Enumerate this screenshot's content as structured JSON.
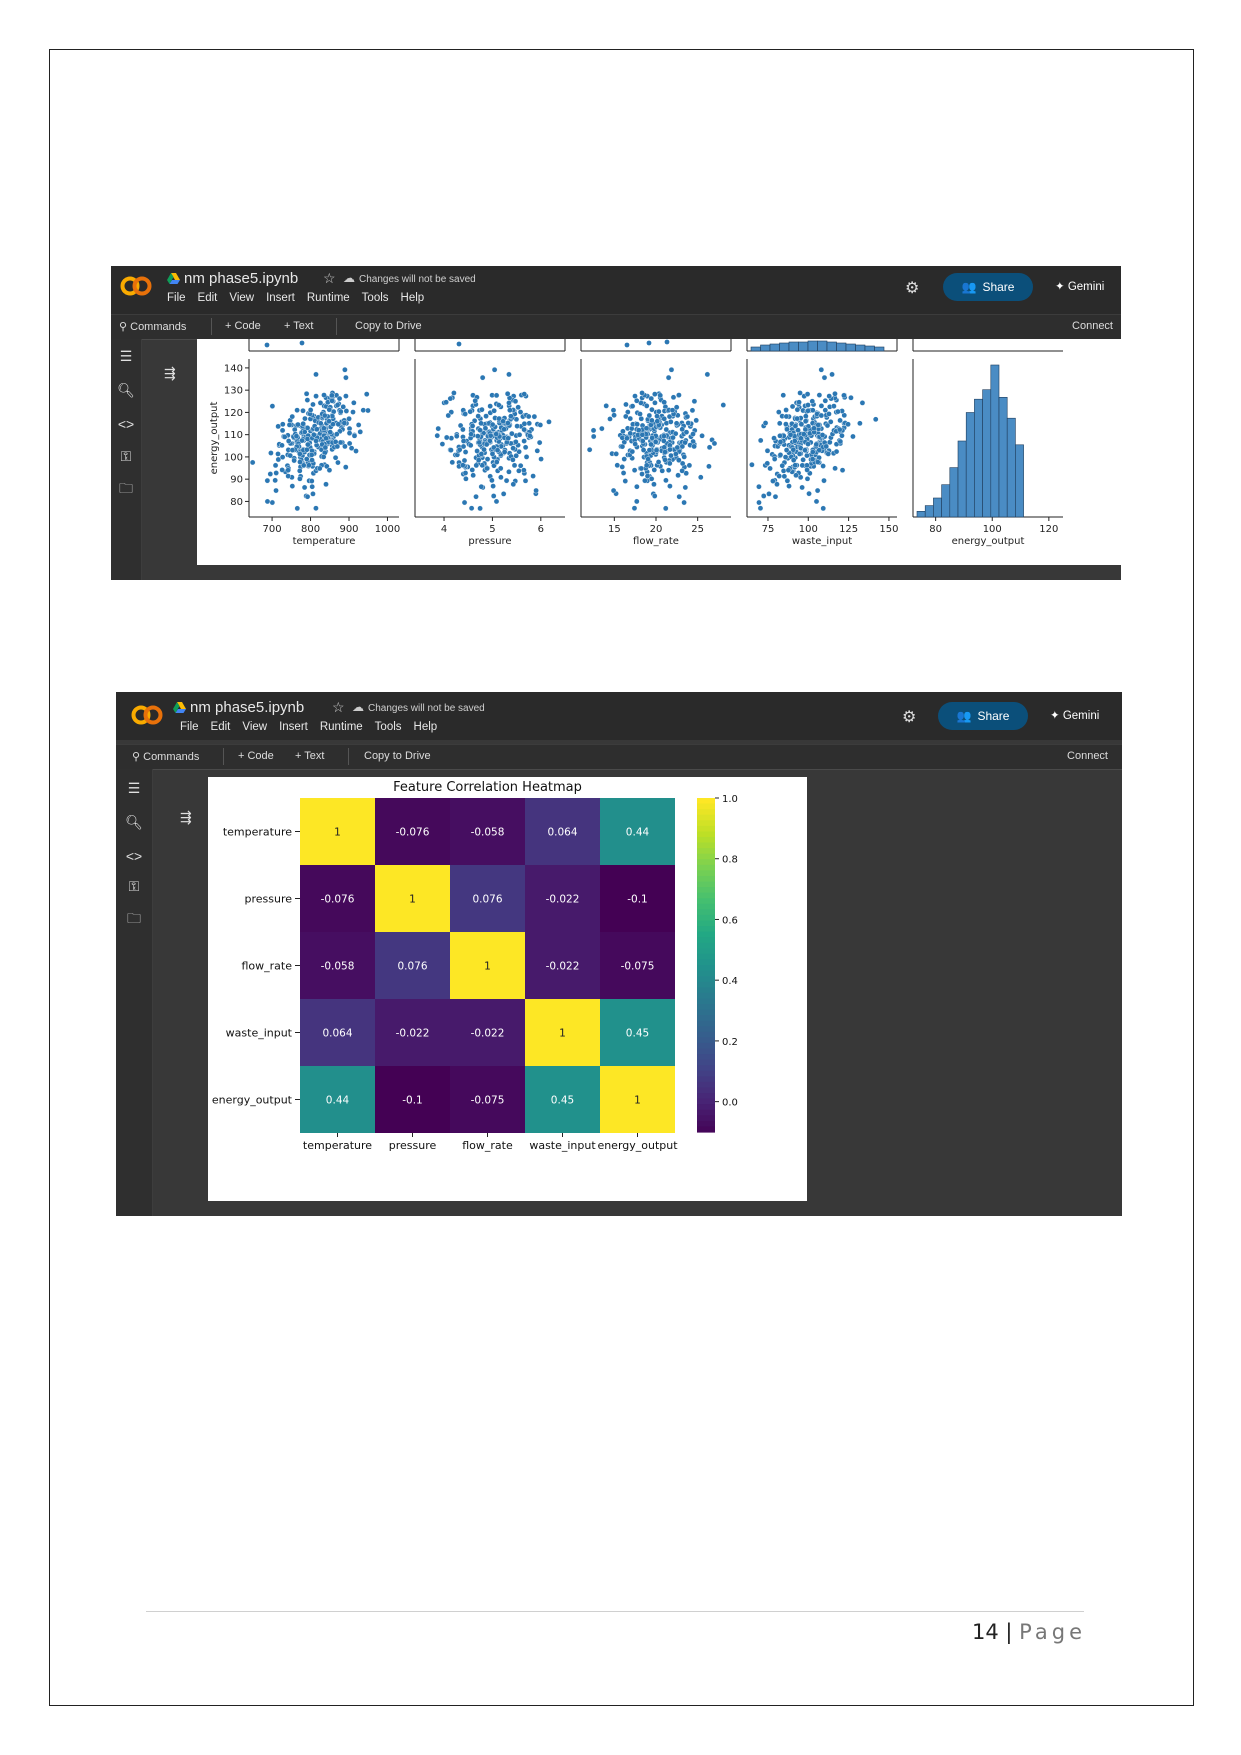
{
  "app": {
    "notebook_title": "nm phase5.ipynb",
    "save_status": "Changes will not be saved",
    "menu": [
      "File",
      "Edit",
      "View",
      "Insert",
      "Runtime",
      "Tools",
      "Help"
    ],
    "share_label": "Share",
    "gemini_label": "Gemini",
    "toolbar": {
      "commands": "Commands",
      "add_code": "+ Code",
      "add_text": "+ Text",
      "copy_to_drive": "Copy to Drive",
      "connect": "Connect"
    },
    "colors": {
      "share_bg": "#0b4f7a",
      "bar_bg": "#2a2a2a",
      "body_bg": "#383838",
      "logo_orange": "#f9ab00"
    },
    "sidebar_icons": [
      "toc-icon",
      "find-icon",
      "code-snippets-icon",
      "secrets-key-icon",
      "files-folder-icon"
    ]
  },
  "chart_data": [
    {
      "type": "scatter",
      "description_panels": "pairplot bottom row",
      "ylabel": "energy_output",
      "y_ticks": [
        80,
        90,
        100,
        110,
        120,
        130,
        140
      ],
      "panels": [
        {
          "xlabel": "temperature",
          "x_ticks": [
            700,
            800,
            900,
            1000
          ],
          "xlim": [
            640,
            1030
          ],
          "mean": 810,
          "sd": 55
        },
        {
          "xlabel": "pressure",
          "x_ticks": [
            4,
            5,
            6
          ],
          "xlim": [
            3.4,
            6.5
          ],
          "mean": 5.0,
          "sd": 0.5
        },
        {
          "xlabel": "flow_rate",
          "x_ticks": [
            15,
            20,
            25
          ],
          "xlim": [
            11,
            29
          ],
          "mean": 20,
          "sd": 2.8
        },
        {
          "xlabel": "waste_input",
          "x_ticks": [
            75,
            100,
            125,
            150
          ],
          "xlim": [
            62,
            155
          ],
          "mean": 100,
          "sd": 14
        },
        {
          "xlabel": "energy_output",
          "x_ticks": [
            80,
            100,
            120
          ],
          "type": "histogram",
          "bin_counts": [
            3,
            6,
            10,
            17,
            26,
            40,
            55,
            62,
            67,
            80,
            63,
            52,
            38
          ]
        }
      ],
      "ylim": [
        73,
        144
      ]
    },
    {
      "type": "heatmap",
      "title": "Feature Correlation Heatmap",
      "labels": [
        "temperature",
        "pressure",
        "flow_rate",
        "waste_input",
        "energy_output"
      ],
      "matrix": [
        [
          "1",
          "-0.076",
          "-0.058",
          "0.064",
          "0.44"
        ],
        [
          "-0.076",
          "1",
          "0.076",
          "-0.022",
          "-0.1"
        ],
        [
          "-0.058",
          "0.076",
          "1",
          "-0.022",
          "-0.075"
        ],
        [
          "0.064",
          "-0.022",
          "-0.022",
          "1",
          "0.45"
        ],
        [
          "0.44",
          "-0.1",
          "-0.075",
          "0.45",
          "1"
        ]
      ],
      "colorbar_ticks": [
        "0.0",
        "0.2",
        "0.4",
        "0.6",
        "0.8",
        "1.0"
      ],
      "vmin": -0.1,
      "vmax": 1.0,
      "colormap": "viridis"
    }
  ],
  "footer": {
    "page_number": "14",
    "separator": "|",
    "page_word": "Page"
  }
}
